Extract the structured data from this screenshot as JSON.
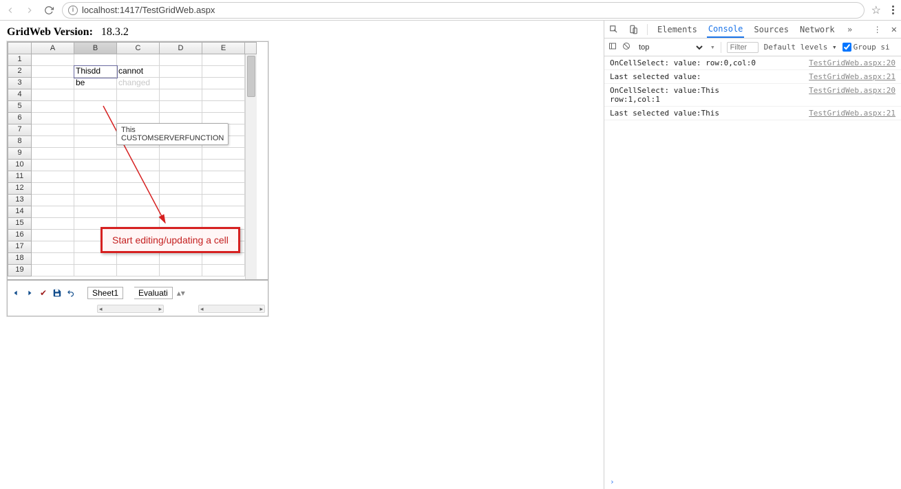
{
  "browser": {
    "url": "localhost:1417/TestGridWeb.aspx"
  },
  "page": {
    "title_label": "GridWeb Version:",
    "version": "18.3.2"
  },
  "grid": {
    "columns": [
      "A",
      "B",
      "C",
      "D",
      "E"
    ],
    "row_count": 19,
    "cells": {
      "B2": "Thisdd",
      "C2": "cannot",
      "B3": "be",
      "C3_ghost": "changed"
    },
    "editing_cell": "B2",
    "tooltip": {
      "line1": "This",
      "line2": "CUSTOMSERVERFUNCTION"
    },
    "sheet_tabs": [
      "Sheet1",
      "Evaluati"
    ]
  },
  "annotation": {
    "text": "Start editing/updating a cell"
  },
  "devtools": {
    "tabs": [
      "Elements",
      "Console",
      "Sources",
      "Network"
    ],
    "active_tab": "Console",
    "context": "top",
    "filter_placeholder": "Filter",
    "levels_label": "Default levels",
    "group_label": "Group si",
    "logs": [
      {
        "msg": "OnCellSelect: value: row:0,col:0",
        "src": "TestGridWeb.aspx:20"
      },
      {
        "msg": "Last selected value:",
        "src": "TestGridWeb.aspx:21"
      },
      {
        "msg": "OnCellSelect: value:This\nrow:1,col:1",
        "src": "TestGridWeb.aspx:20"
      },
      {
        "msg": "Last selected value:This",
        "src": "TestGridWeb.aspx:21"
      }
    ]
  }
}
